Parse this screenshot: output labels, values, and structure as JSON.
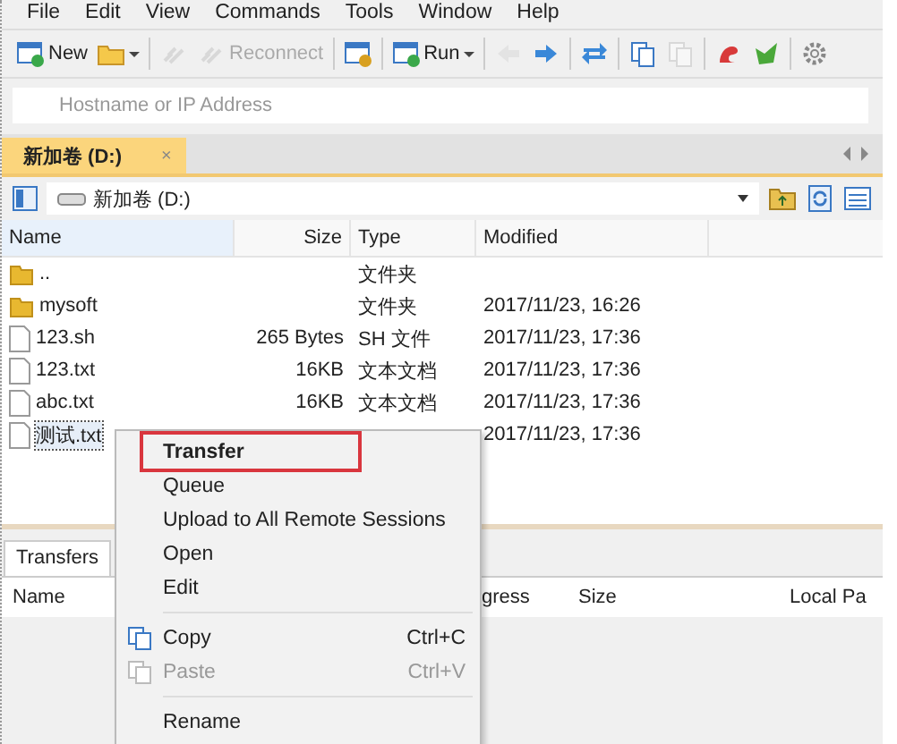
{
  "menu_bar": [
    "File",
    "Edit",
    "View",
    "Commands",
    "Tools",
    "Window",
    "Help"
  ],
  "toolbar": [
    {
      "kind": "button",
      "label": "New",
      "disabled": false
    },
    {
      "kind": "button",
      "disabled": false
    },
    {
      "kind": "separator"
    },
    {
      "kind": "button",
      "disabled": true
    },
    {
      "kind": "button",
      "label": "Reconnect",
      "disabled": true
    },
    {
      "kind": "separator"
    },
    {
      "kind": "button",
      "disabled": false
    },
    {
      "kind": "separator"
    },
    {
      "kind": "button",
      "label": "Run",
      "disabled": false
    },
    {
      "kind": "separator"
    },
    {
      "kind": "button",
      "disabled": true
    },
    {
      "kind": "button",
      "disabled": false
    },
    {
      "kind": "separator"
    },
    {
      "kind": "button",
      "disabled": false
    },
    {
      "kind": "separator"
    },
    {
      "kind": "button",
      "disabled": false
    },
    {
      "kind": "button",
      "disabled": true
    },
    {
      "kind": "separator"
    },
    {
      "kind": "button",
      "disabled": false
    },
    {
      "kind": "button",
      "disabled": false
    },
    {
      "kind": "separator"
    },
    {
      "kind": "button",
      "disabled": false
    }
  ],
  "host_field": {
    "placeholder": "Hostname or IP Address"
  },
  "tabs": [
    {
      "label": "新加卷 (D:)",
      "selected": true,
      "close": "×"
    }
  ],
  "path_bar": {
    "location": "新加卷 (D:)"
  },
  "file_list": {
    "columns": [
      "Name",
      "Size",
      "Type",
      "Modified"
    ],
    "rows": [
      {
        "kind": "folder",
        "name": "..",
        "size": "",
        "type": "文件夹",
        "modified": "",
        "selected": false
      },
      {
        "kind": "folder",
        "name": "mysoft",
        "size": "",
        "type": "文件夹",
        "modified": "2017/11/23, 16:26",
        "selected": false
      },
      {
        "kind": "file",
        "name": "123.sh",
        "size": "265 Bytes",
        "type": "SH 文件",
        "modified": "2017/11/23, 17:36",
        "selected": false
      },
      {
        "kind": "file",
        "name": "123.txt",
        "size": "16KB",
        "type": "文本文档",
        "modified": "2017/11/23, 17:36",
        "selected": false
      },
      {
        "kind": "file",
        "name": "abc.txt",
        "size": "16KB",
        "type": "文本文档",
        "modified": "2017/11/23, 17:36",
        "selected": false
      },
      {
        "kind": "file",
        "name": "测试.txt",
        "size": "",
        "type": "",
        "modified": "2017/11/23, 17:36",
        "selected": true
      }
    ]
  },
  "transfers": {
    "tabs": [
      {
        "label": "Transfers",
        "selected": true
      }
    ],
    "columns": [
      "Name",
      "gress",
      "Size",
      "Local Pa"
    ]
  },
  "context_menu": [
    {
      "kind": "item",
      "label": "Transfer",
      "selected": true,
      "disabled": false
    },
    {
      "kind": "item",
      "label": "Queue",
      "selected": false,
      "disabled": false
    },
    {
      "kind": "item",
      "label": "Upload to All Remote Sessions",
      "selected": false,
      "disabled": false
    },
    {
      "kind": "item",
      "label": "Open",
      "selected": false,
      "disabled": false
    },
    {
      "kind": "item",
      "label": "Edit",
      "selected": false,
      "disabled": false
    },
    {
      "kind": "separator"
    },
    {
      "kind": "item",
      "label": "Copy",
      "shortcut": "Ctrl+C",
      "selected": false,
      "disabled": false
    },
    {
      "kind": "item",
      "label": "Paste",
      "shortcut": "Ctrl+V",
      "selected": false,
      "disabled": true
    },
    {
      "kind": "separator"
    },
    {
      "kind": "item",
      "label": "Rename",
      "selected": false,
      "disabled": false
    }
  ]
}
